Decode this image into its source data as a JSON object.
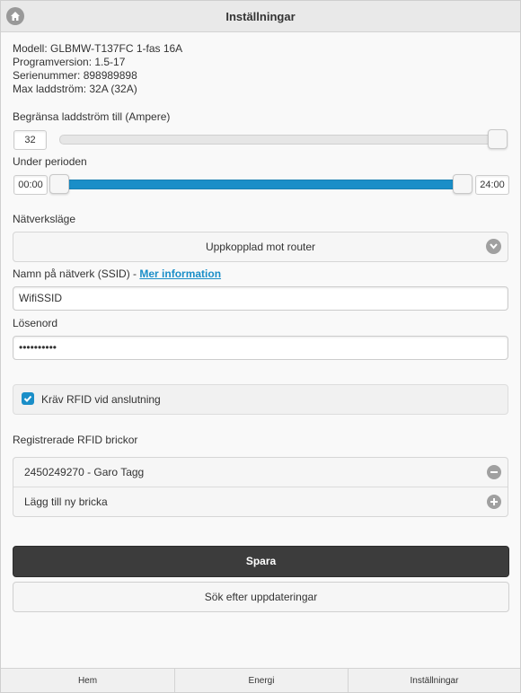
{
  "header": {
    "title": "Inställningar"
  },
  "device_info": {
    "model": "Modell: GLBMW-T137FC 1-fas 16A",
    "program_version": "Programversion: 1.5-17",
    "serial_number": "Serienummer: 898989898",
    "max_current": "Max laddström: 32A (32A)"
  },
  "current_limit": {
    "label": "Begränsa laddström till (Ampere)",
    "value": "32",
    "slider_fraction": 1.0
  },
  "period": {
    "label": "Under perioden",
    "start": "00:00",
    "end": "24:00"
  },
  "network_mode": {
    "label": "Nätverksläge",
    "selected": "Uppkopplad mot router"
  },
  "ssid": {
    "label": "Namn på nätverk (SSID) - ",
    "more_info_link": "Mer information",
    "value": "WifiSSID"
  },
  "password": {
    "label": "Lösenord",
    "value": "password12"
  },
  "rfid_required": {
    "label": "Kräv RFID vid anslutning",
    "checked": true
  },
  "rfid_tags": {
    "label": "Registrerade RFID brickor",
    "items": [
      {
        "text": "2450249270 - Garo Tagg",
        "icon": "minus-circle-icon"
      }
    ],
    "add_label": "Lägg till ny bricka"
  },
  "actions": {
    "save": "Spara",
    "check_updates": "Sök efter uppdateringar"
  },
  "footer": {
    "tabs": [
      "Hem",
      "Energi",
      "Inställningar"
    ]
  },
  "colors": {
    "accent": "#1a8ec8",
    "dark_button": "#3c3c3c"
  }
}
